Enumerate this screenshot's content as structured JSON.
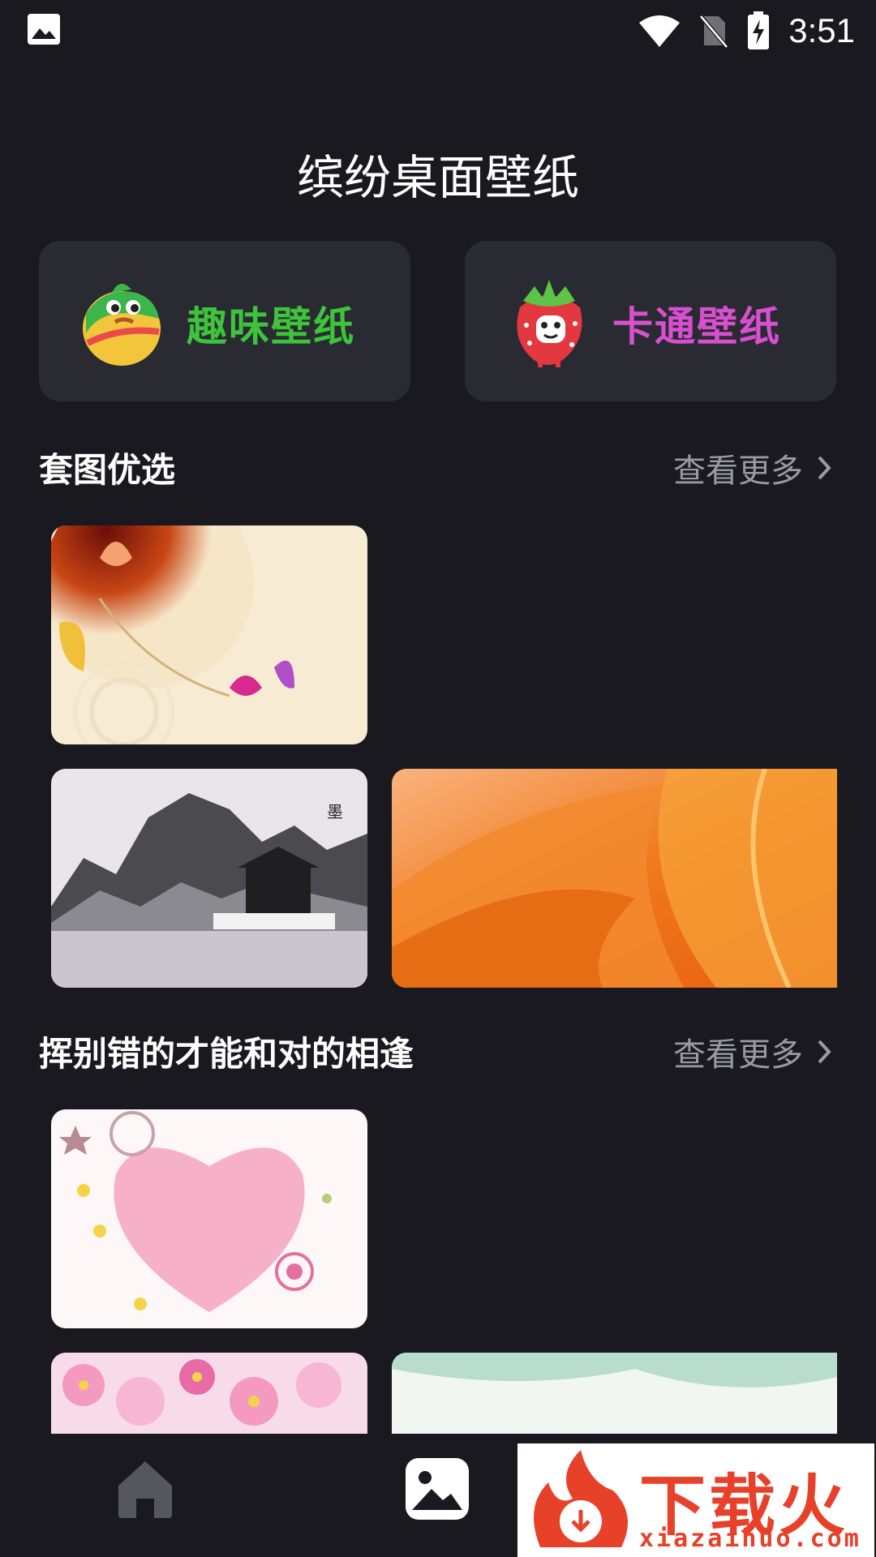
{
  "status_bar": {
    "time": "3:51",
    "icons": [
      "gallery-icon",
      "wifi-icon",
      "no-sim-icon",
      "battery-charging-icon"
    ]
  },
  "app": {
    "title": "缤纷桌面壁纸"
  },
  "categories": [
    {
      "label": "趣味壁纸",
      "icon": "melon-mascot-icon",
      "color": "#3ec43a"
    },
    {
      "label": "卡通壁纸",
      "icon": "strawberry-mascot-icon",
      "color": "#d84fcf"
    }
  ],
  "sections": [
    {
      "title": "套图优选",
      "more": "查看更多"
    },
    {
      "title": "挥别错的才能和对的相逢",
      "more": "查看更多"
    }
  ],
  "bottom_nav": {
    "items": [
      "home-icon",
      "wallpaper-icon"
    ],
    "active": "wallpaper-icon"
  },
  "watermark": {
    "text": "下载火",
    "url": "xiazaihuo.com"
  }
}
